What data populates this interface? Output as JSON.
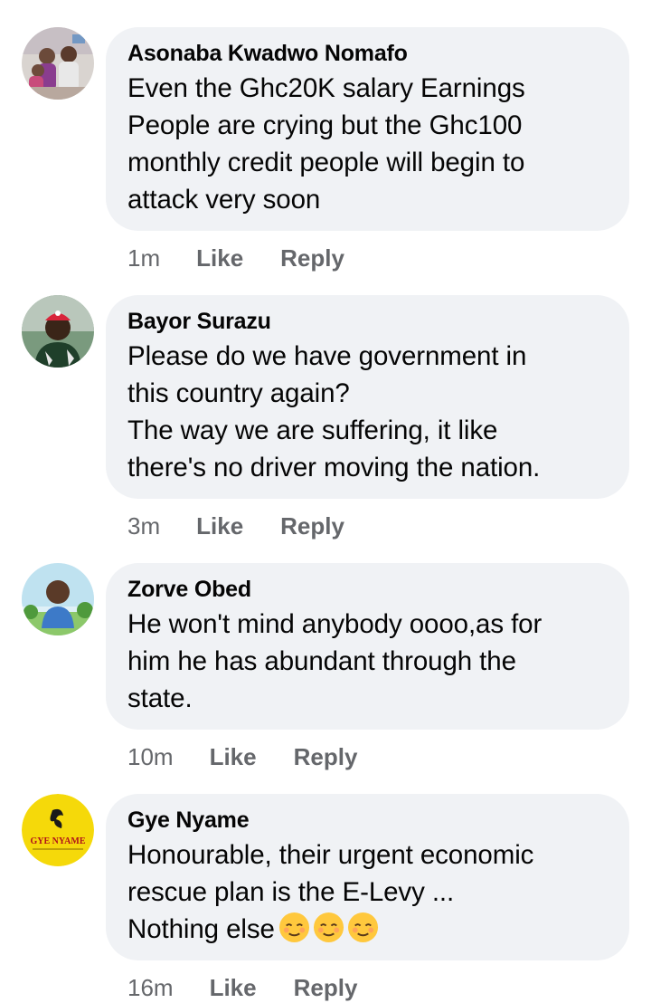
{
  "comments": [
    {
      "author": "Asonaba Kwadwo Nomafo",
      "text": "Even the Ghc20K salary Earnings\nPeople are crying but the Ghc100\nmonthly credit people will begin to\nattack very soon",
      "time": "1m",
      "like": "Like",
      "reply": "Reply",
      "avatar_icon": "group-photo-avatar"
    },
    {
      "author": "Bayor Surazu",
      "text": "Please do we have government in\nthis country again?\nThe way we are suffering, it like\nthere's no driver moving the nation.",
      "time": "3m",
      "like": "Like",
      "reply": "Reply",
      "avatar_icon": "man-in-red-cap-avatar"
    },
    {
      "author": "Zorve Obed",
      "text": "He won't mind anybody oooo,as for\nhim he has abundant through the\nstate.",
      "time": "10m",
      "like": "Like",
      "reply": "Reply",
      "avatar_icon": "man-outdoors-avatar"
    },
    {
      "author": "Gye Nyame",
      "text": "Honourable, their urgent economic\nrescue plan is the E-Levy ...\nNothing else",
      "emoji_count": 3,
      "time": "16m",
      "like": "Like",
      "reply": "Reply",
      "avatar_icon": "gye-nyame-logo-avatar",
      "avatar_logo_text": "GYE NYAME"
    }
  ],
  "colors": {
    "bubble": "#f0f2f5",
    "text": "#050505",
    "meta": "#65676b",
    "logo_yellow": "#f5d90a"
  }
}
